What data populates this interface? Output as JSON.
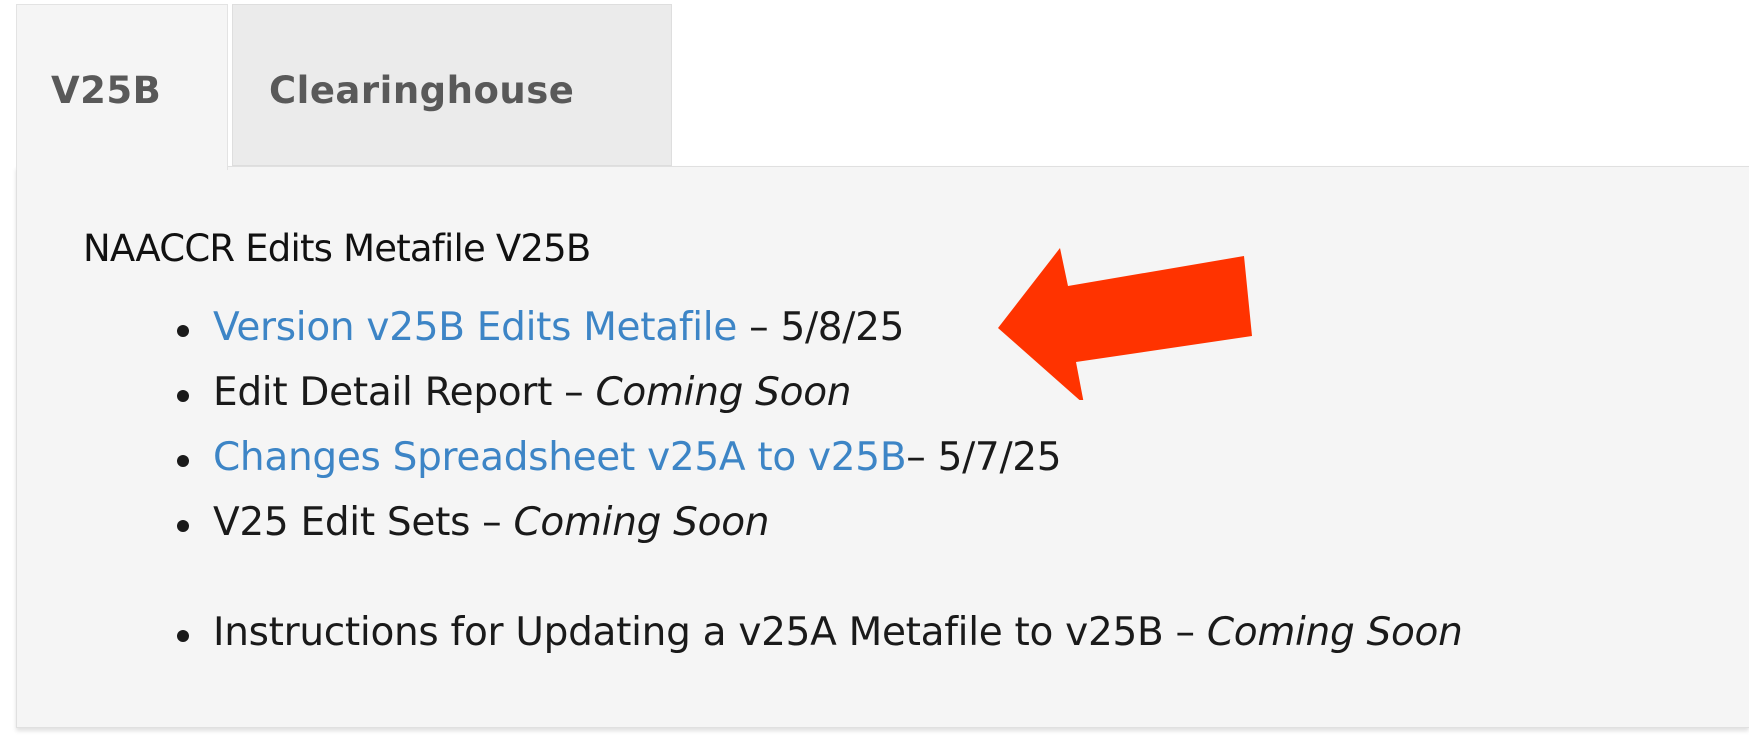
{
  "tabs": [
    {
      "label": "V25B",
      "active": true
    },
    {
      "label": "Clearinghouse",
      "active": false
    }
  ],
  "panel": {
    "title": "NAACCR Edits Metafile V25B",
    "items": [
      {
        "link": "Version v25B Edits Metafile",
        "suffix": " – 5/8/25"
      },
      {
        "text": "Edit Detail Report – ",
        "status": "Coming Soon"
      },
      {
        "link": "Changes Spreadsheet v25A to v25B",
        "suffix": "– 5/7/25"
      },
      {
        "text": "V25 Edit Sets – ",
        "status": "Coming Soon"
      },
      {
        "text": "Instructions for Updating a v25A Metafile to v25B – ",
        "status": "Coming Soon"
      }
    ]
  },
  "colors": {
    "link": "#3d85c6",
    "arrow": "#ff3300",
    "panel_bg": "#f5f5f5",
    "inactive_tab_bg": "#ebebeb"
  },
  "icons": {
    "annotation": "red-arrow-icon"
  }
}
